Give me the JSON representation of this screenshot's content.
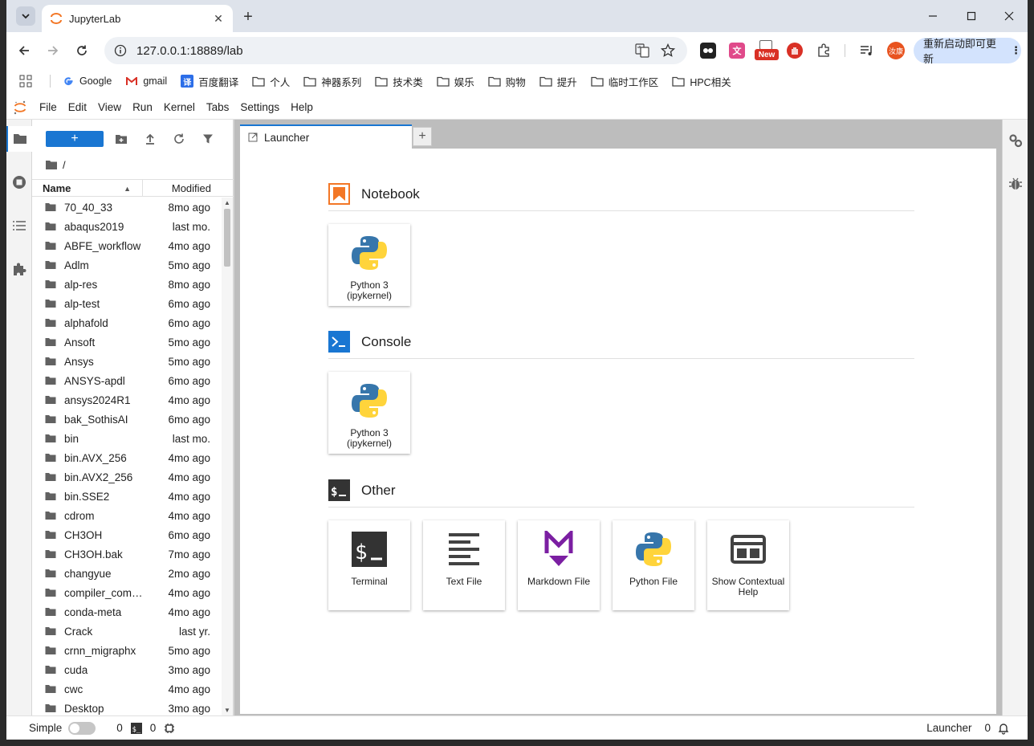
{
  "browser": {
    "tab_title": "JupyterLab",
    "url": "127.0.0.1:18889/lab",
    "update_button": "重新启动即可更新",
    "new_badge": "New",
    "profile_initials": "汝康",
    "bookmarks": [
      "Google",
      "gmail",
      "百度翻译",
      "个人",
      "神器系列",
      "技术类",
      "娱乐",
      "购物",
      "提升",
      "临时工作区",
      "HPC相关"
    ]
  },
  "menu": [
    "File",
    "Edit",
    "View",
    "Run",
    "Kernel",
    "Tabs",
    "Settings",
    "Help"
  ],
  "filebrowser": {
    "new_label": "+",
    "path": "/",
    "col_name": "Name",
    "col_modified": "Modified",
    "files": [
      {
        "name": "70_40_33",
        "modified": "8mo ago"
      },
      {
        "name": "abaqus2019",
        "modified": "last mo."
      },
      {
        "name": "ABFE_workflow",
        "modified": "4mo ago"
      },
      {
        "name": "Adlm",
        "modified": "5mo ago"
      },
      {
        "name": "alp-res",
        "modified": "8mo ago"
      },
      {
        "name": "alp-test",
        "modified": "6mo ago"
      },
      {
        "name": "alphafold",
        "modified": "6mo ago"
      },
      {
        "name": "Ansoft",
        "modified": "5mo ago"
      },
      {
        "name": "Ansys",
        "modified": "5mo ago"
      },
      {
        "name": "ANSYS-apdl",
        "modified": "6mo ago"
      },
      {
        "name": "ansys2024R1",
        "modified": "4mo ago"
      },
      {
        "name": "bak_SothisAI",
        "modified": "6mo ago"
      },
      {
        "name": "bin",
        "modified": "last mo."
      },
      {
        "name": "bin.AVX_256",
        "modified": "4mo ago"
      },
      {
        "name": "bin.AVX2_256",
        "modified": "4mo ago"
      },
      {
        "name": "bin.SSE2",
        "modified": "4mo ago"
      },
      {
        "name": "cdrom",
        "modified": "4mo ago"
      },
      {
        "name": "CH3OH",
        "modified": "6mo ago"
      },
      {
        "name": "CH3OH.bak",
        "modified": "7mo ago"
      },
      {
        "name": "changyue",
        "modified": "2mo ago"
      },
      {
        "name": "compiler_compat",
        "modified": "4mo ago"
      },
      {
        "name": "conda-meta",
        "modified": "4mo ago"
      },
      {
        "name": "Crack",
        "modified": "last yr."
      },
      {
        "name": "crnn_migraphx",
        "modified": "5mo ago"
      },
      {
        "name": "cuda",
        "modified": "3mo ago"
      },
      {
        "name": "cwc",
        "modified": "4mo ago"
      },
      {
        "name": "Desktop",
        "modified": "3mo ago"
      }
    ]
  },
  "dock": {
    "tab_label": "Launcher",
    "add_label": "+"
  },
  "launcher": {
    "notebook": {
      "title": "Notebook",
      "cards": [
        {
          "label": "Python 3 (ipykernel)"
        }
      ]
    },
    "console": {
      "title": "Console",
      "cards": [
        {
          "label": "Python 3 (ipykernel)"
        }
      ]
    },
    "other": {
      "title": "Other",
      "cards": [
        {
          "label": "Terminal"
        },
        {
          "label": "Text File"
        },
        {
          "label": "Markdown File"
        },
        {
          "label": "Python File"
        },
        {
          "label": "Show Contextual Help"
        }
      ]
    }
  },
  "statusbar": {
    "simple_label": "Simple",
    "terminals_count": "0",
    "kernels_count": "0",
    "mode": "Launcher",
    "notifications": "0"
  },
  "colors": {
    "accent": "#1976d2",
    "notebook_icon": "#f37726",
    "console_icon": "#1976d2",
    "other_icon": "#333333"
  }
}
